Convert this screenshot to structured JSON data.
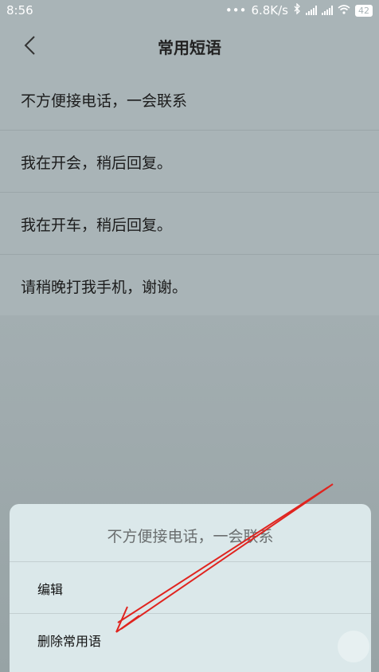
{
  "status_bar": {
    "time": "8:56",
    "network_speed": "6.8K/s",
    "battery": "42",
    "icons": [
      "more-dots-icon",
      "bluetooth-icon",
      "signal-icon",
      "signal-icon",
      "wifi-icon",
      "battery-icon"
    ]
  },
  "header": {
    "title": "常用短语",
    "back_icon": "chevron-left-icon"
  },
  "phrases": [
    {
      "text": "不方便接电话，一会联系"
    },
    {
      "text": "我在开会，稍后回复。"
    },
    {
      "text": "我在开车，稍后回复。"
    },
    {
      "text": "请稍晚打我手机，谢谢。"
    }
  ],
  "sheet": {
    "title": "不方便接电话，一会联系",
    "options": [
      {
        "label": "编辑"
      },
      {
        "label": "删除常用语"
      }
    ]
  },
  "colors": {
    "background_dim": "#a9b4b7",
    "sheet_bg": "#dbe8ea",
    "annotation_arrow": "#e0241f"
  }
}
